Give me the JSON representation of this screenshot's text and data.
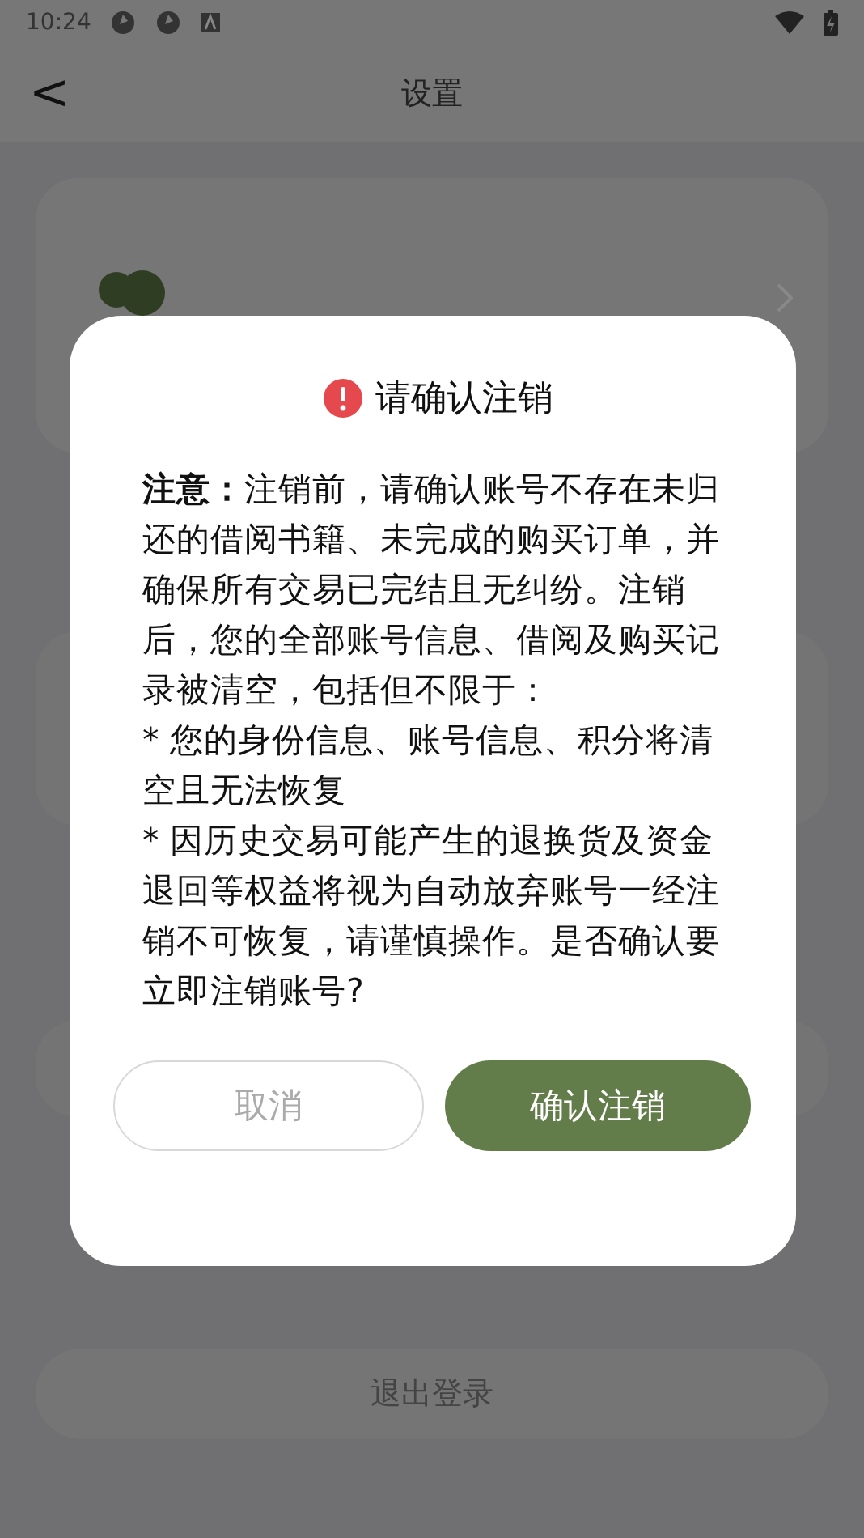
{
  "status_bar": {
    "time": "10:24"
  },
  "header": {
    "back": "<",
    "title": "设置"
  },
  "logout_button": "退出登录",
  "dialog": {
    "title": "请确认注销",
    "paragraphs": [
      "**注意：**注销前，请确认账号不存在未归还的借阅书籍、未完成的购买订单，并确保所有交易已完结且无纠纷。注销后，您的全部账号信息、借阅及购买记录被清空，包括但不限于：",
      "* 您的身份信息、账号信息、积分将清空且无法恢复",
      "* 因历史交易可能产生的退换货及资金退回等权益将视为自动放弃账号一经注销不可恢复，请谨慎操作。是否确认要立即注销账号?"
    ],
    "buttons": [
      {
        "label": "取消",
        "kind": "secondary"
      },
      {
        "label": "确认注销",
        "kind": "primary"
      }
    ]
  }
}
